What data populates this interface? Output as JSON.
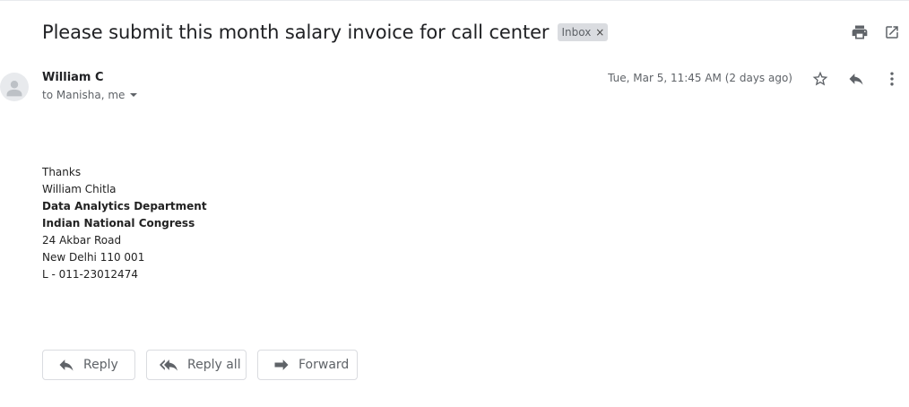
{
  "subject": "Please submit this month salary invoice for call center",
  "label": {
    "text": "Inbox",
    "remove": "×"
  },
  "toolbar": {
    "print_icon": "printer-icon",
    "popout_icon": "open-in-new-window-icon"
  },
  "sender": {
    "name": "William C",
    "recipients": "to Manisha, me",
    "timestamp": "Tue, Mar 5, 11:45 AM (2 days ago)"
  },
  "message_actions": {
    "star_icon": "star-icon",
    "reply_icon": "reply-icon",
    "more_icon": "more-vertical-icon"
  },
  "body": {
    "lines": [
      {
        "text": "Thanks",
        "bold": false
      },
      {
        "text": "William Chitla",
        "bold": false
      },
      {
        "text": "Data Analytics Department",
        "bold": true
      },
      {
        "text": "Indian National Congress",
        "bold": true
      },
      {
        "text": "24 Akbar Road",
        "bold": false
      },
      {
        "text": "New Delhi 110 001",
        "bold": false
      },
      {
        "text": "L - 011-23012474",
        "bold": false
      }
    ]
  },
  "buttons": {
    "reply": "Reply",
    "reply_all": "Reply all",
    "forward": "Forward"
  }
}
